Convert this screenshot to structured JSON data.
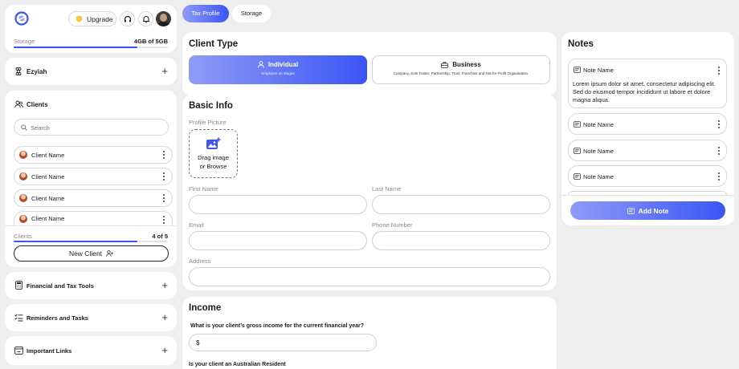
{
  "header": {
    "upgrade_label": "Upgrade",
    "storage_label": "Storage",
    "storage_value": "4GB of 5GB",
    "storage_fraction": 0.8
  },
  "tabs": [
    {
      "label": "Tax Profile",
      "active": true
    },
    {
      "label": "Storage",
      "active": false
    }
  ],
  "sidebar": {
    "workspace": "Ezyiah",
    "clients_title": "Clients",
    "search_placeholder": "Search",
    "clients": [
      {
        "name": "Client Name"
      },
      {
        "name": "Client Name"
      },
      {
        "name": "Client Name"
      },
      {
        "name": "Client Name"
      }
    ],
    "clients_count_label": "Clients",
    "clients_count_value": "4 of 5",
    "clients_fraction": 0.8,
    "new_client_label": "New Client",
    "sections": [
      {
        "label": "Financial and Tax Tools"
      },
      {
        "label": "Reminders and Tasks"
      },
      {
        "label": "Important Links"
      }
    ]
  },
  "client_type": {
    "title": "Client Type",
    "options": [
      {
        "label": "Individual",
        "sub": "Employee on Wages",
        "selected": true
      },
      {
        "label": "Business",
        "sub": "Company, Sole Trader, Partnership, Trust, Franchise and Not-for-Profit Organisation.",
        "selected": false
      }
    ]
  },
  "basic_info": {
    "title": "Basic Info",
    "profile_label": "Profile Picture",
    "drop_text_1": "Drag image",
    "drop_text_2": "or Browse",
    "first_name": "First Name",
    "last_name": "Last Name",
    "email": "Email",
    "phone": "Phone Number",
    "address": "Address"
  },
  "income": {
    "title": "Income",
    "question": "What is your client’s gross income for the current financial year?",
    "currency": "$",
    "question2": "Is your client an Australian Resident"
  },
  "notes": {
    "title": "Notes",
    "items": [
      {
        "name": "Note Name",
        "body": "Lorem ipsum dolor sit amet, consectetur adipiscing elit. Sed do eiusmod tempor incididunt ut labore et dolore magna aliqua."
      },
      {
        "name": "Note Name",
        "body": ""
      },
      {
        "name": "Note Name",
        "body": ""
      },
      {
        "name": "Note Name",
        "body": ""
      }
    ],
    "add_label": "Add Note"
  },
  "colors": {
    "accent": "#3b55f5",
    "accent_light": "#8f9cf7",
    "upgrade_icon": "#f5c542"
  }
}
